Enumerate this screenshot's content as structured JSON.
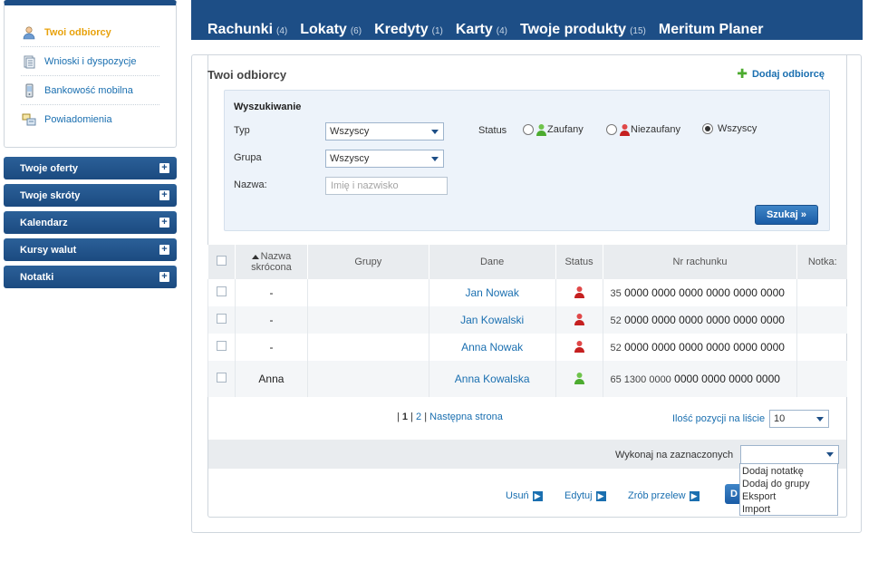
{
  "sidebar": {
    "sub_items": [
      {
        "label": "Twoi odbiorcy",
        "icon": "person-icon",
        "active": true
      },
      {
        "label": "Wnioski i dyspozycje",
        "icon": "document-icon",
        "active": false
      },
      {
        "label": "Bankowość mobilna",
        "icon": "mobile-phone-icon",
        "active": false
      },
      {
        "label": "Powiadomienia",
        "icon": "notification-icon",
        "active": false
      }
    ],
    "sections": [
      {
        "label": "Twoje oferty"
      },
      {
        "label": "Twoje skróty"
      },
      {
        "label": "Kalendarz"
      },
      {
        "label": "Kursy walut"
      },
      {
        "label": "Notatki"
      }
    ]
  },
  "topnav": [
    {
      "label": "Rachunki",
      "count": "(4)"
    },
    {
      "label": "Lokaty",
      "count": "(6)"
    },
    {
      "label": "Kredyty",
      "count": "(1)"
    },
    {
      "label": "Karty",
      "count": "(4)"
    },
    {
      "label": "Twoje produkty",
      "count": "(15)"
    },
    {
      "label": "Meritum Planer",
      "count": ""
    }
  ],
  "main": {
    "title": "Twoi odbiorcy",
    "add_label": "Dodaj odbiorcę"
  },
  "search": {
    "title": "Wyszukiwanie",
    "type_label": "Typ",
    "type_value": "Wszyscy",
    "group_label": "Grupa",
    "group_value": "Wszyscy",
    "name_label": "Nazwa:",
    "name_placeholder": "Imię i nazwisko",
    "status_label": "Status",
    "status_options": [
      "Zaufany",
      "Niezaufany",
      "Wszyscy"
    ],
    "status_selected": "Wszyscy",
    "button": "Szukaj"
  },
  "table": {
    "headers": {
      "short": "Nazwa skrócona",
      "groups": "Grupy",
      "data": "Dane",
      "status": "Status",
      "account": "Nr rachunku",
      "note": "Notka:"
    },
    "rows": [
      {
        "short": "-",
        "groups": "",
        "name": "Jan Nowak",
        "status": "untrusted",
        "acct_prefix": "35",
        "acct_main": "0000 0000 0000 0000 0000 0000",
        "note": ""
      },
      {
        "short": "-",
        "groups": "",
        "name": "Jan Kowalski",
        "status": "untrusted",
        "acct_prefix": "52",
        "acct_main": "0000 0000 0000 0000 0000 0000",
        "note": ""
      },
      {
        "short": "-",
        "groups": "",
        "name": "Anna Nowak",
        "status": "untrusted",
        "acct_prefix": "52",
        "acct_main": "0000 0000 0000 0000 0000 0000",
        "note": ""
      },
      {
        "short": "Anna",
        "groups": "",
        "name": "Anna Kowalska",
        "status": "trusted",
        "acct_prefix": "65 1300 0000",
        "acct_main": "0000 0000 0000 0000",
        "note": ""
      }
    ]
  },
  "pager": {
    "sep1": "| ",
    "current": "1",
    "sep2": " | ",
    "page2": "2",
    "sep3": " | ",
    "next": "Następna strona",
    "per_page_label": "Ilość pozycji na liście",
    "per_page_value": "10"
  },
  "bulk": {
    "label": "Wykonaj na zaznaczonych",
    "value": "",
    "options": [
      "Dodaj notatkę",
      "Dodaj do grupy",
      "Eksport",
      "Import"
    ]
  },
  "footer_actions": [
    {
      "label": "Usuń"
    },
    {
      "label": "Edytuj"
    },
    {
      "label": "Zrób przelew"
    }
  ],
  "footer_button_partial": "D",
  "colors": {
    "brand": "#1d4e86",
    "link": "#1a6fb0",
    "active": "#e8a20c",
    "trusted": "#4cab2f",
    "untrusted": "#d02a2a"
  }
}
